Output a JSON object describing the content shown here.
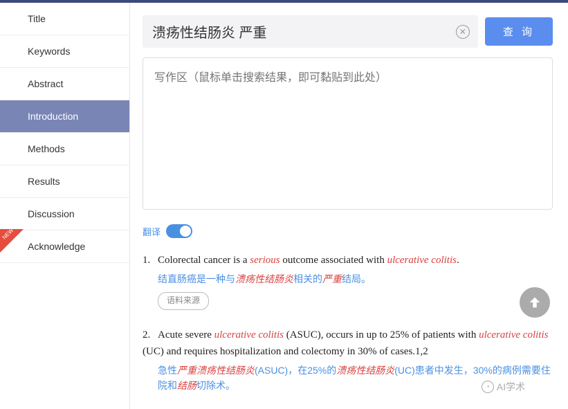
{
  "sidebar": {
    "items": [
      {
        "label": "Title"
      },
      {
        "label": "Keywords"
      },
      {
        "label": "Abstract"
      },
      {
        "label": "Introduction"
      },
      {
        "label": "Methods"
      },
      {
        "label": "Results"
      },
      {
        "label": "Discussion"
      },
      {
        "label": "Acknowledge"
      }
    ],
    "new_badge": "NEW"
  },
  "search": {
    "value": "溃疡性结肠炎 严重",
    "query_btn": "查 询"
  },
  "writing_area": {
    "placeholder": "写作区（鼠标单击搜索结果，即可黏贴到此处）"
  },
  "translate": {
    "label": "翻译"
  },
  "results": [
    {
      "num": "1.",
      "en_pre": "Colorectal cancer is a ",
      "en_hl1": "serious",
      "en_mid": " outcome associated with ",
      "en_hl2": "ulcerative colitis",
      "en_post": ".",
      "zh_pre": "结直肠癌是一种与",
      "zh_hl1": "溃疡性结肠炎",
      "zh_mid": "相关的",
      "zh_hl2": "严重",
      "zh_post": "结局。",
      "source": "语料来源"
    },
    {
      "num": "2.",
      "en_pre": "Acute severe ",
      "en_hl1": "ulcerative colitis",
      "en_mid": " (ASUC), occurs in up to 25% of patients with ",
      "en_hl2": "ulcerative colitis",
      "en_post": " (UC) and requires hospitalization and colectomy in 30% of cases.1,2",
      "zh_pre": "急性",
      "zh_hl1": "严重溃疡性结肠炎",
      "zh_mid": "(ASUC)，在25%的",
      "zh_hl2": "溃疡性结肠炎",
      "zh_mid2": "(UC)患者中发生，30%的病例需要住院和",
      "zh_hl3": "结肠",
      "zh_post": "切除术。"
    }
  ],
  "watermark": "AI学术"
}
